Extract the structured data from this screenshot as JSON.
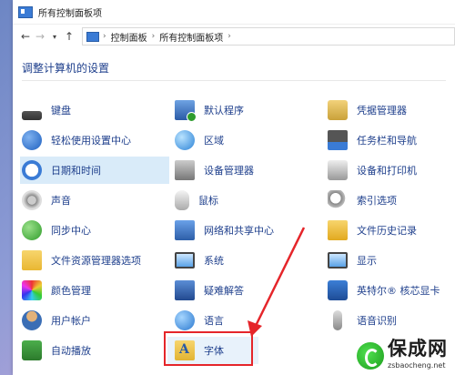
{
  "window": {
    "title": "所有控制面板项"
  },
  "nav": {
    "back_icon": "arrow-left-icon",
    "forward_icon": "arrow-right-icon",
    "recent_icon": "chevron-down-icon",
    "up_icon": "arrow-up-icon",
    "crumbs": [
      "控制面板",
      "所有控制面板项"
    ],
    "separator": "›"
  },
  "heading": "调整计算机的设置",
  "items": [
    {
      "label": "键盘",
      "icon": "keyboard-icon"
    },
    {
      "label": "默认程序",
      "icon": "default-programs-icon"
    },
    {
      "label": "凭据管理器",
      "icon": "credential-manager-icon"
    },
    {
      "label": "轻松使用设置中心",
      "icon": "ease-of-access-icon"
    },
    {
      "label": "区域",
      "icon": "region-globe-icon"
    },
    {
      "label": "任务栏和导航",
      "icon": "taskbar-icon"
    },
    {
      "label": "日期和时间",
      "icon": "clock-calendar-icon"
    },
    {
      "label": "设备管理器",
      "icon": "device-manager-icon"
    },
    {
      "label": "设备和打印机",
      "icon": "printer-icon"
    },
    {
      "label": "声音",
      "icon": "speaker-icon"
    },
    {
      "label": "鼠标",
      "icon": "mouse-icon"
    },
    {
      "label": "索引选项",
      "icon": "magnifier-icon"
    },
    {
      "label": "同步中心",
      "icon": "sync-icon"
    },
    {
      "label": "网络和共享中心",
      "icon": "network-icon"
    },
    {
      "label": "文件历史记录",
      "icon": "file-history-icon"
    },
    {
      "label": "文件资源管理器选项",
      "icon": "folder-options-icon"
    },
    {
      "label": "系统",
      "icon": "system-monitor-icon"
    },
    {
      "label": "显示",
      "icon": "display-monitor-icon"
    },
    {
      "label": "颜色管理",
      "icon": "color-management-icon"
    },
    {
      "label": "疑难解答",
      "icon": "troubleshooting-icon"
    },
    {
      "label": "英特尔® 核芯显卡",
      "icon": "intel-graphics-icon"
    },
    {
      "label": "用户帐户",
      "icon": "user-accounts-icon"
    },
    {
      "label": "语言",
      "icon": "language-icon"
    },
    {
      "label": "语音识别",
      "icon": "microphone-icon"
    },
    {
      "label": "自动播放",
      "icon": "autoplay-icon"
    },
    {
      "label": "字体",
      "icon": "fonts-icon"
    }
  ],
  "watermark": {
    "main": "保成网",
    "sub": "zsbaocheng.net"
  },
  "colors": {
    "link": "#1e3f8c",
    "selected": "#d9ebf9",
    "annotation": "#e5252a"
  }
}
